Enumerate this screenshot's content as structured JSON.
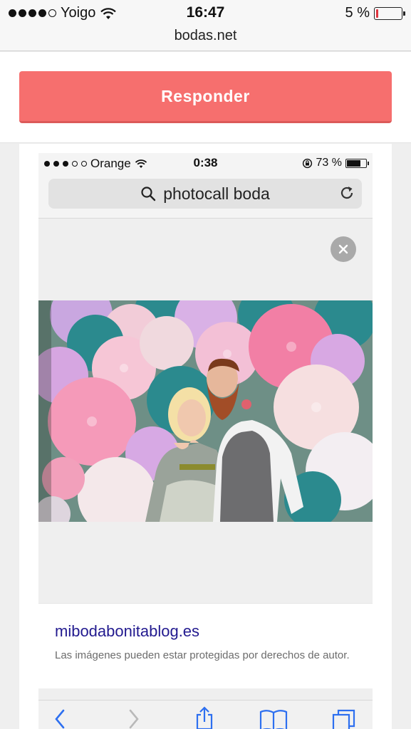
{
  "status_bar": {
    "carrier": "Yoigo",
    "time": "16:47",
    "battery_percent": "5 %"
  },
  "browser": {
    "domain": "bodas.net"
  },
  "actions": {
    "respond_label": "Responder"
  },
  "embedded_screenshot": {
    "status_bar": {
      "carrier": "Orange",
      "time": "0:38",
      "battery_percent": "73 %"
    },
    "search": {
      "query": "photocall boda"
    },
    "image": {
      "description_icon": "photo-of-couple-at-paper-fan-photocall"
    },
    "source": {
      "site": "mibodabonitablog.es",
      "copyright_note": "Las imágenes pueden estar protegidas por derechos de autor."
    },
    "toolbar": {
      "icons": [
        "back-icon",
        "forward-icon",
        "share-icon",
        "bookmarks-icon",
        "tabs-icon"
      ]
    }
  },
  "colors": {
    "accent": "#f66f6e",
    "link": "#221a8f"
  }
}
